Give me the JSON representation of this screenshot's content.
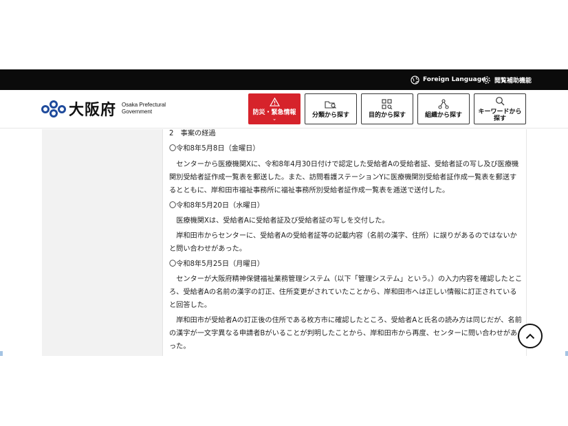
{
  "utility_bar": {
    "foreign_language": "Foreign Language",
    "accessibility": "閲覧補助機能"
  },
  "logo": {
    "name": "大阪府",
    "sub_line1": "Osaka Prefectural",
    "sub_line2": "Government"
  },
  "nav": {
    "disaster": "防災・緊急情報",
    "category": "分類から探す",
    "purpose": "目的から探す",
    "org": "組織から探す",
    "keyword_line1": "キーワードから",
    "keyword_line2": "探す"
  },
  "content": {
    "lines": [
      "2　事案の経過",
      "〇令和8年5月8日（金曜日）",
      "センターから医療機関Xに、令和8年4月30日付けで認定した受給者Aの受給者証、受給者証の写し及び医療機関別受給者証作成一覧表を郵送した。また、訪問看護ステーションYに医療機関別受給者証作成一覧表を郵送するとともに、岸和田市福祉事務所に福祉事務所別受給者証作成一覧表を逓送で送付した。",
      "〇令和8年5月20日（水曜日）",
      "医療機関Xは、受給者Aに受給者証及び受給者証の写しを交付した。",
      "岸和田市からセンターに、受給者Aの受給者証等の記載内容（名前の漢字、住所）に誤りがあるのではないかと問い合わせがあった。",
      "〇令和8年5月25日（月曜日）",
      "センターが大阪府精神保健福祉業務管理システム（以下「管理システム」という。）の入力内容を確認したところ、受給者Aの名前の漢字の訂正、住所変更がされていたことから、岸和田市へは正しい情報に訂正されていると回答した。",
      "岸和田市が受給者Aの訂正後の住所である枚方市に確認したところ、受給者Aと氏名の読み方は同じだが、名前の漢字が一文字異なる申請者Bがいることが判明したことから、岸和田市から再度、センターに問い合わせがあった。"
    ]
  },
  "colors": {
    "topbar": "#0b0b0b",
    "disaster_red": "#d6232b",
    "logo_blue": "#1f4b9c"
  }
}
